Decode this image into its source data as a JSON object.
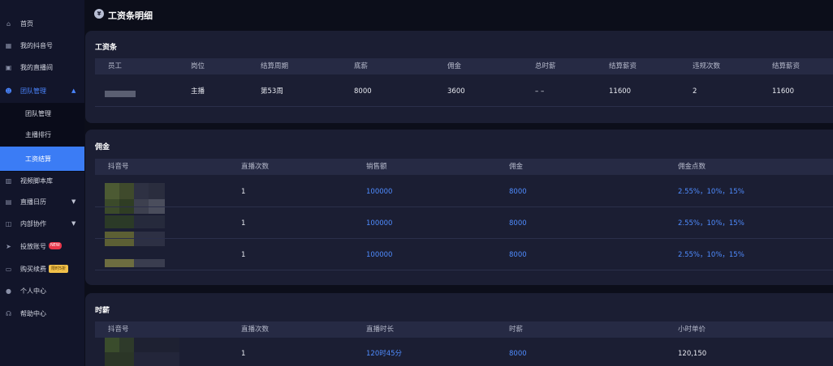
{
  "sidebar": {
    "items": [
      {
        "label": "首页",
        "icon": "home-icon"
      },
      {
        "label": "我的抖音号",
        "icon": "grid-icon"
      },
      {
        "label": "我的直播间",
        "icon": "live-icon"
      },
      {
        "label": "团队管理",
        "icon": "team-icon"
      },
      {
        "label": "视频脚本库",
        "icon": "bar-icon"
      },
      {
        "label": "直播日历",
        "icon": "calendar-icon"
      },
      {
        "label": "内部协作",
        "icon": "collab-icon"
      },
      {
        "label": "投放账号",
        "icon": "send-icon",
        "badge": "NEW"
      },
      {
        "label": "购买续费",
        "icon": "card-icon",
        "badge": "限时5折"
      },
      {
        "label": "个人中心",
        "icon": "user-icon"
      },
      {
        "label": "帮助中心",
        "icon": "help-icon"
      }
    ],
    "submenu": [
      {
        "label": "团队管理"
      },
      {
        "label": "主播排行"
      },
      {
        "label": "工资结算"
      }
    ]
  },
  "page": {
    "title": "工资条明细"
  },
  "salary": {
    "title": "工资条",
    "headers": [
      "员工",
      "岗位",
      "结算周期",
      "底薪",
      "佣金",
      "总时薪",
      "结算薪资",
      "违规次数",
      "结算薪资"
    ],
    "row": [
      "",
      "主播",
      "第53周",
      "8000",
      "3600",
      "– –",
      "11600",
      "2",
      "11600"
    ]
  },
  "commission": {
    "title": "佣金",
    "headers": [
      "抖音号",
      "直播次数",
      "销售额",
      "佣金",
      "佣金点数"
    ],
    "rows": [
      [
        "",
        "1",
        "100000",
        "8000",
        "2.55%，10%，15%"
      ],
      [
        "",
        "1",
        "100000",
        "8000",
        "2.55%，10%，15%"
      ],
      [
        "",
        "1",
        "100000",
        "8000",
        "2.55%，10%，15%"
      ]
    ]
  },
  "hourly": {
    "title": "时薪",
    "headers": [
      "抖音号",
      "直播次数",
      "直播时长",
      "时薪",
      "小时单价"
    ],
    "rows": [
      [
        "",
        "1",
        "120时45分",
        "8000",
        "120,150"
      ]
    ]
  },
  "colors": {
    "accent": "#3b7cf5",
    "link": "#4f8cff",
    "background": "#0c0e1a",
    "card": "#1b1e33"
  }
}
